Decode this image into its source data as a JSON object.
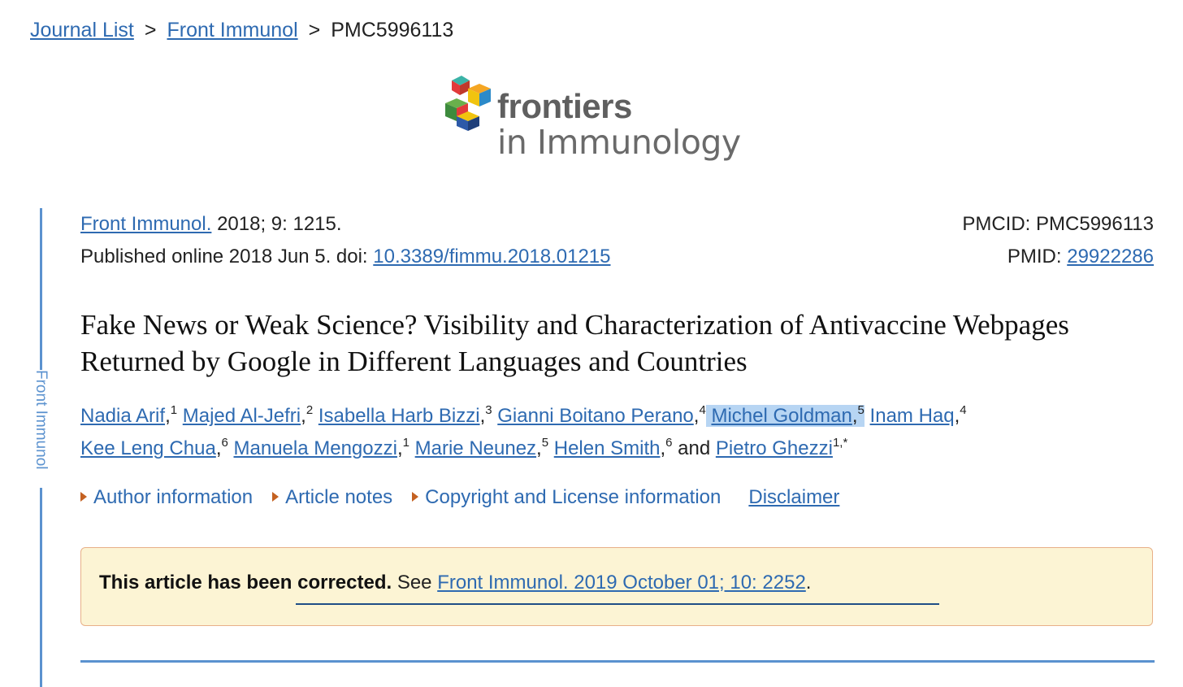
{
  "breadcrumb": {
    "journal_list": "Journal List",
    "sep1": ">",
    "journal": "Front Immunol",
    "sep2": ">",
    "current": "PMC5996113"
  },
  "logo": {
    "line1": "frontiers",
    "line2": "in Immunology",
    "colors": [
      "#e23b3b",
      "#f5a623",
      "#2b8ac9",
      "#6ab04c",
      "#2d5aa8",
      "#f1c40f",
      "#3bb3a7",
      "#c0392b"
    ]
  },
  "side_label": "Front Immunol",
  "citation": {
    "journal_link": "Front Immunol.",
    "details": "2018; 9: 1215.",
    "published": "Published online 2018 Jun 5. doi:",
    "doi": "10.3389/fimmu.2018.01215",
    "pmcid": "PMCID: PMC5996113",
    "pmid_label": "PMID:",
    "pmid": "29922286"
  },
  "title": "Fake News or Weak Science? Visibility and Characterization of Antivaccine Webpages Returned by Google in Different Languages and Countries",
  "authors": [
    {
      "name": "Nadia Arif",
      "sup": "1"
    },
    {
      "name": "Majed Al-Jefri",
      "sup": "2"
    },
    {
      "name": "Isabella Harb Bizzi",
      "sup": "3"
    },
    {
      "name": "Gianni Boitano Perano",
      "sup": "4"
    },
    {
      "name": "Michel Goldman",
      "sup": "5"
    },
    {
      "name": "Inam Haq",
      "sup": "4"
    },
    {
      "name": "Kee Leng Chua",
      "sup": "6"
    },
    {
      "name": "Manuela Mengozzi",
      "sup": "1"
    },
    {
      "name": "Marie Neunez",
      "sup": "5"
    },
    {
      "name": "Helen Smith",
      "sup": "6"
    },
    {
      "name": "Pietro Ghezzi",
      "sup": "1,*"
    }
  ],
  "authors_and": "and",
  "info_links": {
    "author_info": "Author information",
    "article_notes": "Article notes",
    "copyright": "Copyright and License information",
    "disclaimer": "Disclaimer"
  },
  "correction": {
    "bold": "This article has been corrected.",
    "see": "See",
    "link": "Front Immunol. 2019 October 01; 10: 2252",
    "end": "."
  },
  "colors": {
    "link": "#2e6ab1",
    "rail": "#5b92cf",
    "notice_bg": "#fcf4d4",
    "notice_border": "#e8b089",
    "triangle": "#c46121"
  }
}
